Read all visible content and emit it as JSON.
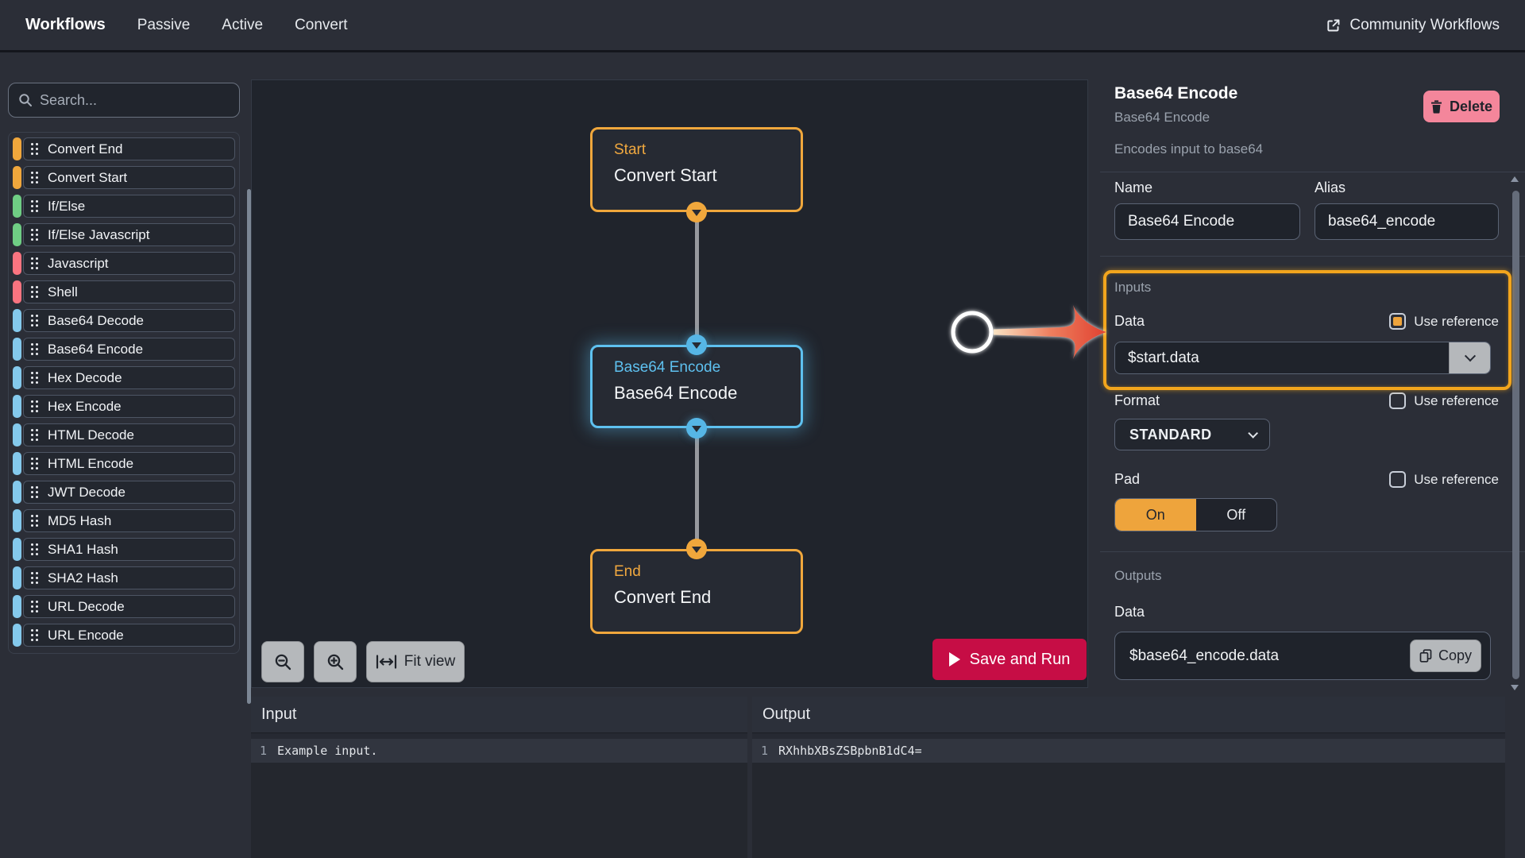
{
  "topbar": {
    "brand": "Workflows",
    "tabs": [
      "Passive",
      "Active",
      "Convert"
    ],
    "community_link": "Community Workflows"
  },
  "sidebar": {
    "search_placeholder": "Search...",
    "items": [
      {
        "label": "Convert End",
        "color": "orange"
      },
      {
        "label": "Convert Start",
        "color": "orange"
      },
      {
        "label": "If/Else",
        "color": "green"
      },
      {
        "label": "If/Else Javascript",
        "color": "green"
      },
      {
        "label": "Javascript",
        "color": "red"
      },
      {
        "label": "Shell",
        "color": "red"
      },
      {
        "label": "Base64 Decode",
        "color": "blue"
      },
      {
        "label": "Base64 Encode",
        "color": "blue"
      },
      {
        "label": "Hex Decode",
        "color": "blue"
      },
      {
        "label": "Hex Encode",
        "color": "blue"
      },
      {
        "label": "HTML Decode",
        "color": "blue"
      },
      {
        "label": "HTML Encode",
        "color": "blue"
      },
      {
        "label": "JWT Decode",
        "color": "blue"
      },
      {
        "label": "MD5 Hash",
        "color": "blue"
      },
      {
        "label": "SHA1 Hash",
        "color": "blue"
      },
      {
        "label": "SHA2 Hash",
        "color": "blue"
      },
      {
        "label": "URL Decode",
        "color": "blue"
      },
      {
        "label": "URL Encode",
        "color": "blue"
      }
    ]
  },
  "canvas": {
    "nodes": [
      {
        "type_label": "Start",
        "name": "Convert Start",
        "color": "orange"
      },
      {
        "type_label": "Base64 Encode",
        "name": "Base64 Encode",
        "color": "blue",
        "selected": true
      },
      {
        "type_label": "End",
        "name": "Convert End",
        "color": "orange"
      }
    ],
    "fit_view_label": "Fit view",
    "run_label": "Save and Run"
  },
  "inspector": {
    "title": "Base64 Encode",
    "subtitle": "Base64 Encode",
    "description": "Encodes input to base64",
    "delete_label": "Delete",
    "name_label": "Name",
    "name_value": "Base64 Encode",
    "alias_label": "Alias",
    "alias_value": "base64_encode",
    "inputs_label": "Inputs",
    "use_reference_label": "Use reference",
    "fields": {
      "data": {
        "label": "Data",
        "value": "$start.data",
        "use_reference": true
      },
      "format": {
        "label": "Format",
        "value": "STANDARD",
        "use_reference": false
      },
      "pad": {
        "label": "Pad",
        "on": "On",
        "off": "Off",
        "selected": "On",
        "use_reference": false
      }
    },
    "outputs_label": "Outputs",
    "output_data_label": "Data",
    "output_value": "$base64_encode.data",
    "copy_label": "Copy"
  },
  "io": {
    "input": {
      "title": "Input",
      "line_number": "1",
      "content": "Example input."
    },
    "output": {
      "title": "Output",
      "line_number": "1",
      "content": "RXhhbXBsZSBpbnB1dC4="
    }
  },
  "colors": {
    "accent_orange": "#f0a73c",
    "accent_green": "#6fce84",
    "accent_red": "#fa7480",
    "accent_blue": "#84c9ec",
    "node_blue": "#5ec1f0",
    "delete_pink": "#f4869b",
    "run_crimson": "#c60d45",
    "annotation_orange": "#f2a51d",
    "arrow_red": "#e0402f"
  }
}
